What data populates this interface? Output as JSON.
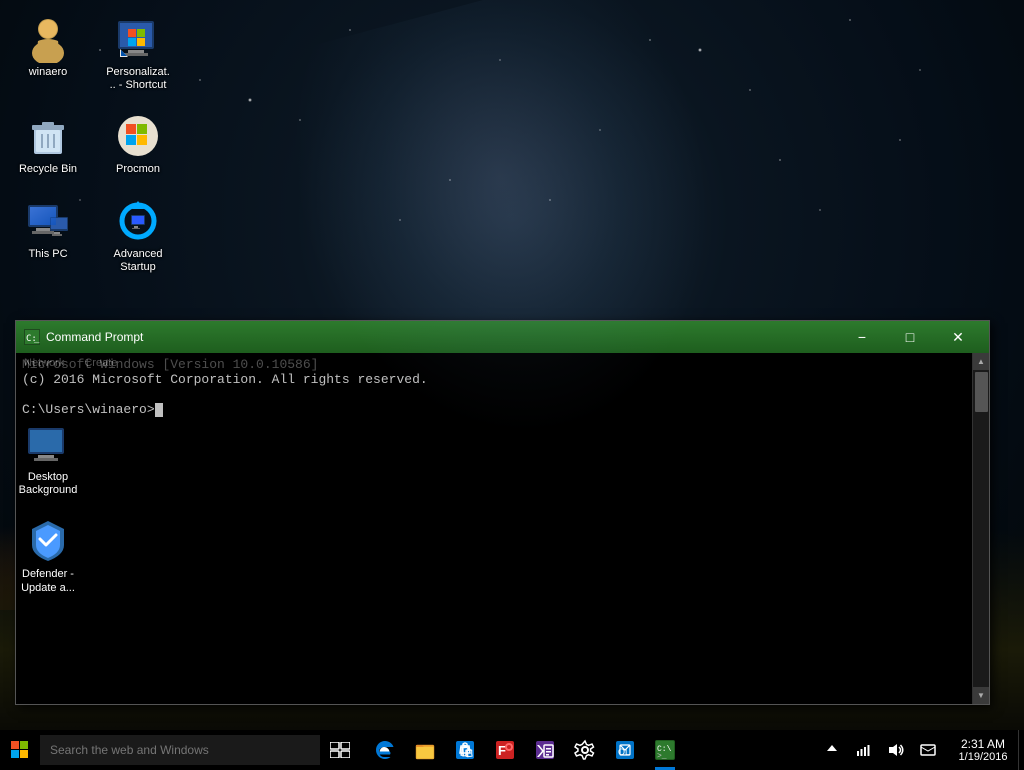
{
  "desktop": {
    "icons": [
      {
        "id": "winaero",
        "label": "winaero",
        "icon_type": "person",
        "col": 0,
        "row": 0
      },
      {
        "id": "personalize",
        "label": "Personalizat... - Shortcut",
        "icon_type": "personalize",
        "col": 1,
        "row": 0
      },
      {
        "id": "recycle-bin",
        "label": "Recycle Bin",
        "icon_type": "recycle",
        "col": 0,
        "row": 1
      },
      {
        "id": "procmon",
        "label": "Procmon",
        "icon_type": "procmon",
        "col": 1,
        "row": 1
      },
      {
        "id": "this-pc",
        "label": "This PC",
        "icon_type": "thispc",
        "col": 0,
        "row": 2
      },
      {
        "id": "advanced-startup",
        "label": "Advanced Startup",
        "icon_type": "refresh",
        "col": 1,
        "row": 2
      }
    ],
    "left_icons": [
      {
        "id": "desktop-bg",
        "label": "Desktop Background",
        "icon_type": "monitor"
      },
      {
        "id": "defender",
        "label": "Defender - Update a...",
        "icon_type": "defender"
      }
    ]
  },
  "cmd_window": {
    "title": "Command Prompt",
    "line1": "Microsoft Windows [Version 10.0.10586]",
    "line2": "(c) 2016 Microsoft Corporation. All rights reserved.",
    "line3": "",
    "prompt": "C:\\Users\\winaero>",
    "menu_items": [
      "Network",
      "Create"
    ]
  },
  "taskbar": {
    "search_placeholder": "Search the web and Windows",
    "time": "2:31 AM",
    "date": "1/19/2016",
    "pinned_apps": [
      {
        "id": "edge",
        "icon": "edge"
      },
      {
        "id": "explorer",
        "icon": "folder"
      },
      {
        "id": "store",
        "icon": "store"
      },
      {
        "id": "fiddler",
        "icon": "fiddler"
      },
      {
        "id": "vs",
        "icon": "vs"
      },
      {
        "id": "settings",
        "icon": "settings"
      },
      {
        "id": "outlook",
        "icon": "outlook"
      },
      {
        "id": "cmd",
        "icon": "cmd",
        "active": true
      }
    ],
    "sys_icons": [
      "chevron",
      "network",
      "volume",
      "message"
    ]
  }
}
